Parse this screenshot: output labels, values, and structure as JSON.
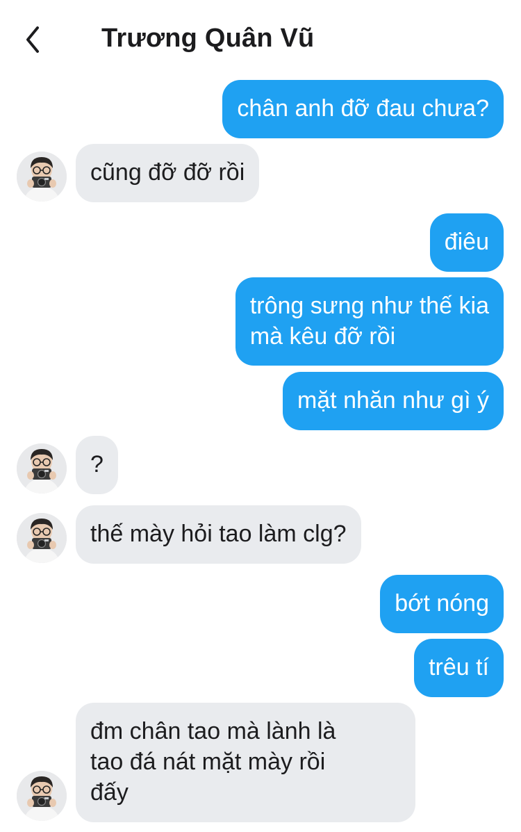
{
  "header": {
    "title": "Trương Quân Vũ",
    "back_icon": "chevron-left-icon"
  },
  "colors": {
    "outgoing_bubble": "#1fa1f2",
    "incoming_bubble": "#e9ebee",
    "outgoing_text": "#ffffff",
    "incoming_text": "#1c1c1e"
  },
  "messages": [
    {
      "direction": "out",
      "text": "chân anh đỡ đau chưa?"
    },
    {
      "direction": "in",
      "text": "cũng đỡ đỡ rồi"
    },
    {
      "direction": "out",
      "text": "điêu"
    },
    {
      "direction": "out",
      "text": "trông sưng như thế kia\nmà kêu đỡ rồi"
    },
    {
      "direction": "out",
      "text": "mặt nhăn như gì ý"
    },
    {
      "direction": "in",
      "text": "?"
    },
    {
      "direction": "in",
      "text": "thế mày hỏi tao làm clg?"
    },
    {
      "direction": "out",
      "text": "bớt nóng"
    },
    {
      "direction": "out",
      "text": "trêu tí"
    },
    {
      "direction": "in",
      "text": "đm chân tao mà lành là\ntao đá nát mặt mày rồi\nđấy"
    }
  ]
}
